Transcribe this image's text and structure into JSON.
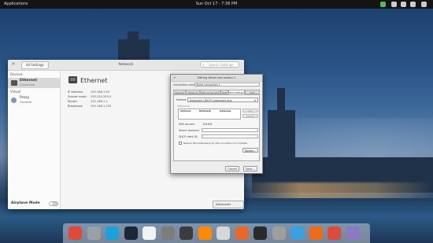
{
  "panel": {
    "applications": "Applications",
    "clock": "Sun Oct 17 · 7:36 PM"
  },
  "window": {
    "back_label": "All Settings",
    "title": "Network",
    "search_placeholder": "Search Settings",
    "sidebar": {
      "devices_heading": "Devices",
      "virtual_heading": "Virtual",
      "items": [
        {
          "name": "Ethernet",
          "status": "Connected"
        },
        {
          "name": "Proxy",
          "status": "Disabled"
        }
      ],
      "airplane_mode": "Airplane Mode"
    },
    "content": {
      "title": "Ethernet",
      "rows": [
        {
          "key": "IP Address:",
          "value": "192.168.1.94"
        },
        {
          "key": "Subnet mask:",
          "value": "255.255.255.0"
        },
        {
          "key": "Router:",
          "value": "192.168.1.1"
        },
        {
          "key": "Broadcast:",
          "value": "192.168.1.255"
        }
      ],
      "advanced_button": "Advanced Settings…"
    }
  },
  "dialog": {
    "title": "Editing Wired connection 1",
    "connection_name_label": "Connection name:",
    "connection_name_value": "Wired connection 1",
    "tabs": [
      "General",
      "Ethernet",
      "802.1X Security",
      "DCB",
      "IPv4 Settings",
      "IPv6 Settings"
    ],
    "method_label": "Method:",
    "method_value": "Automatic (DHCP) addresses only",
    "addresses_label": "Addresses",
    "addr_headers": [
      "Address",
      "Netmask",
      "Gateway"
    ],
    "add_button": "Add",
    "delete_button": "Delete",
    "dns_label": "DNS servers:",
    "dns_value": "8.8.8.8",
    "search_domains_label": "Search domains:",
    "dhcp_client_label": "DHCP client ID:",
    "require_checkbox": "Require IPv4 addressing for this connection to complete",
    "routes_button": "Routes…",
    "cancel_button": "Cancel",
    "save_button": "Save…"
  },
  "dock": {
    "icons": [
      {
        "name": "chrome-icon",
        "color": "#e04a3a"
      },
      {
        "name": "files-icon",
        "color": "#9aa0a6"
      },
      {
        "name": "skype-icon",
        "color": "#1ea0dc"
      },
      {
        "name": "steam-icon",
        "color": "#1b2838"
      },
      {
        "name": "notes-icon",
        "color": "#f2f2f2"
      },
      {
        "name": "calculator-icon",
        "color": "#7c7c7c"
      },
      {
        "name": "screenshot-icon",
        "color": "#3c3c3c"
      },
      {
        "name": "music-icon",
        "color": "#ff8a00"
      },
      {
        "name": "photos-icon",
        "color": "#d7d7d7"
      },
      {
        "name": "install-icon",
        "color": "#e8682a"
      },
      {
        "name": "terminal-icon",
        "color": "#2a2a2a"
      },
      {
        "name": "settings-icon",
        "color": "#9e9e9e"
      },
      {
        "name": "toggle-icon",
        "color": "#3aa0e0"
      },
      {
        "name": "software-icon",
        "color": "#ef6a1a"
      },
      {
        "name": "chrome-alt-icon",
        "color": "#e04a3a"
      },
      {
        "name": "browser-icon",
        "color": "#8b79c8"
      }
    ]
  }
}
